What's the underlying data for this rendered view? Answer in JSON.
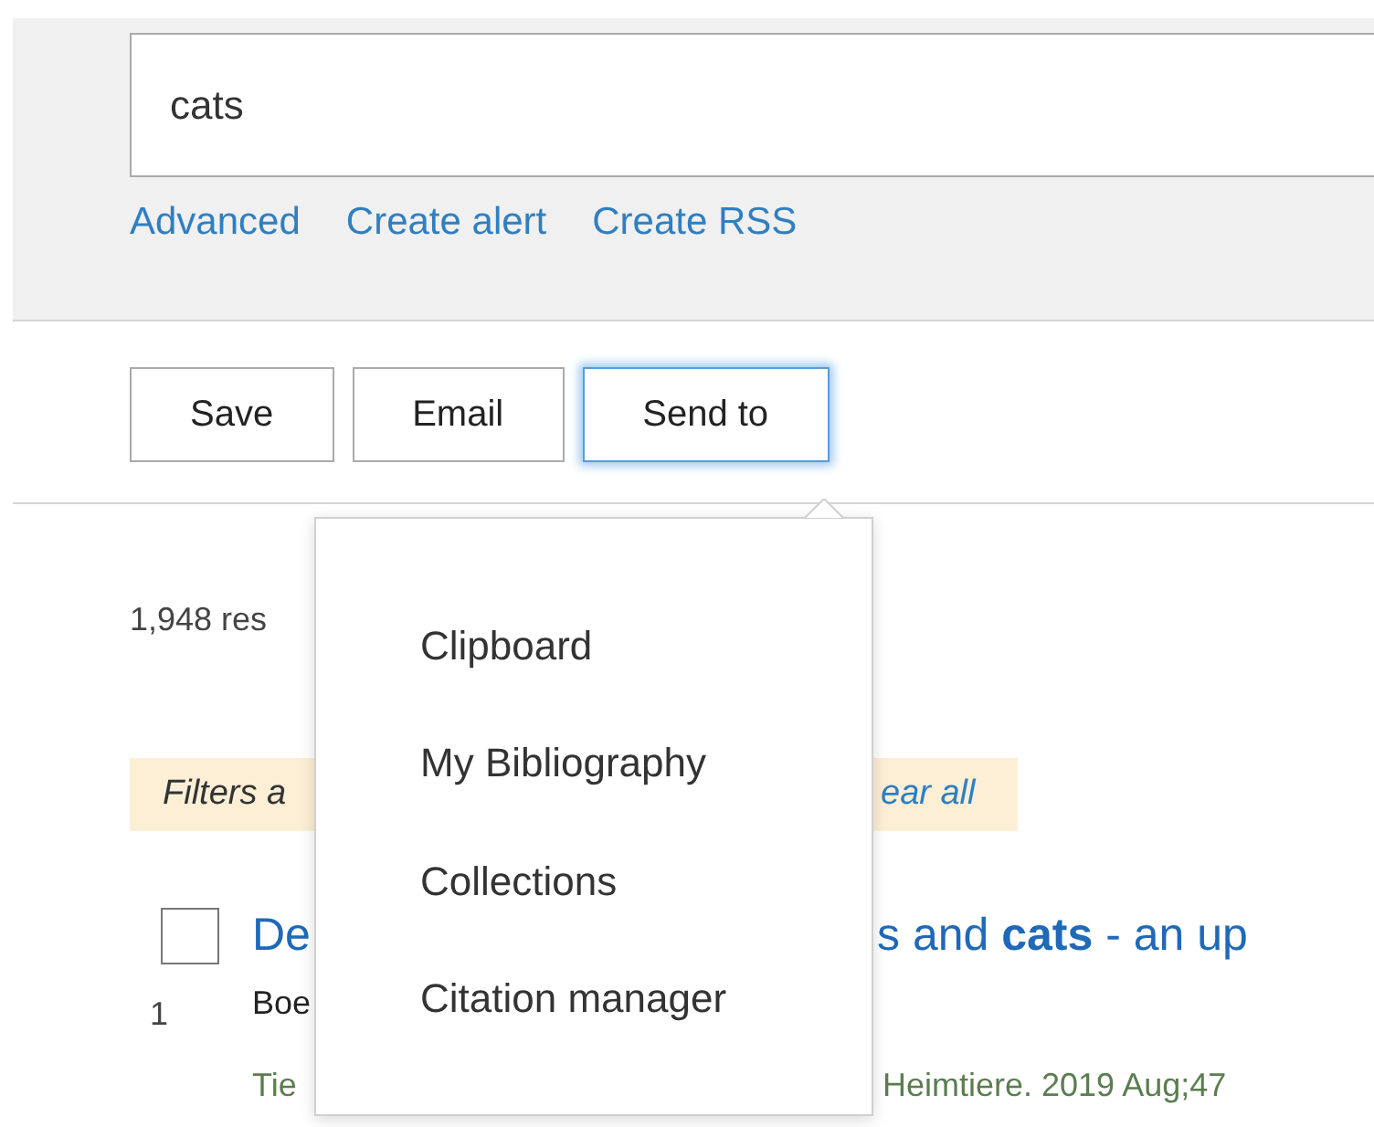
{
  "search": {
    "value": "cats"
  },
  "search_links": [
    "Advanced",
    "Create alert",
    "Create RSS"
  ],
  "actions": [
    {
      "label": "Save",
      "focused": false
    },
    {
      "label": "Email",
      "focused": false
    },
    {
      "label": "Send to",
      "focused": true
    }
  ],
  "send_to_menu": {
    "items": [
      "Clipboard",
      "My Bibliography",
      "Collections",
      "Citation manager"
    ]
  },
  "results_count": "1,948 res",
  "filters": {
    "text": "Filters a",
    "link": "ear all"
  },
  "results": [
    {
      "selected": false,
      "number": "1",
      "title_start": "De",
      "title_end": "s and **cats** - an up",
      "authors": "Boe",
      "journal_start": "Tie",
      "journal_end": "Heimtiere. 2019 Aug;47"
    }
  ]
}
